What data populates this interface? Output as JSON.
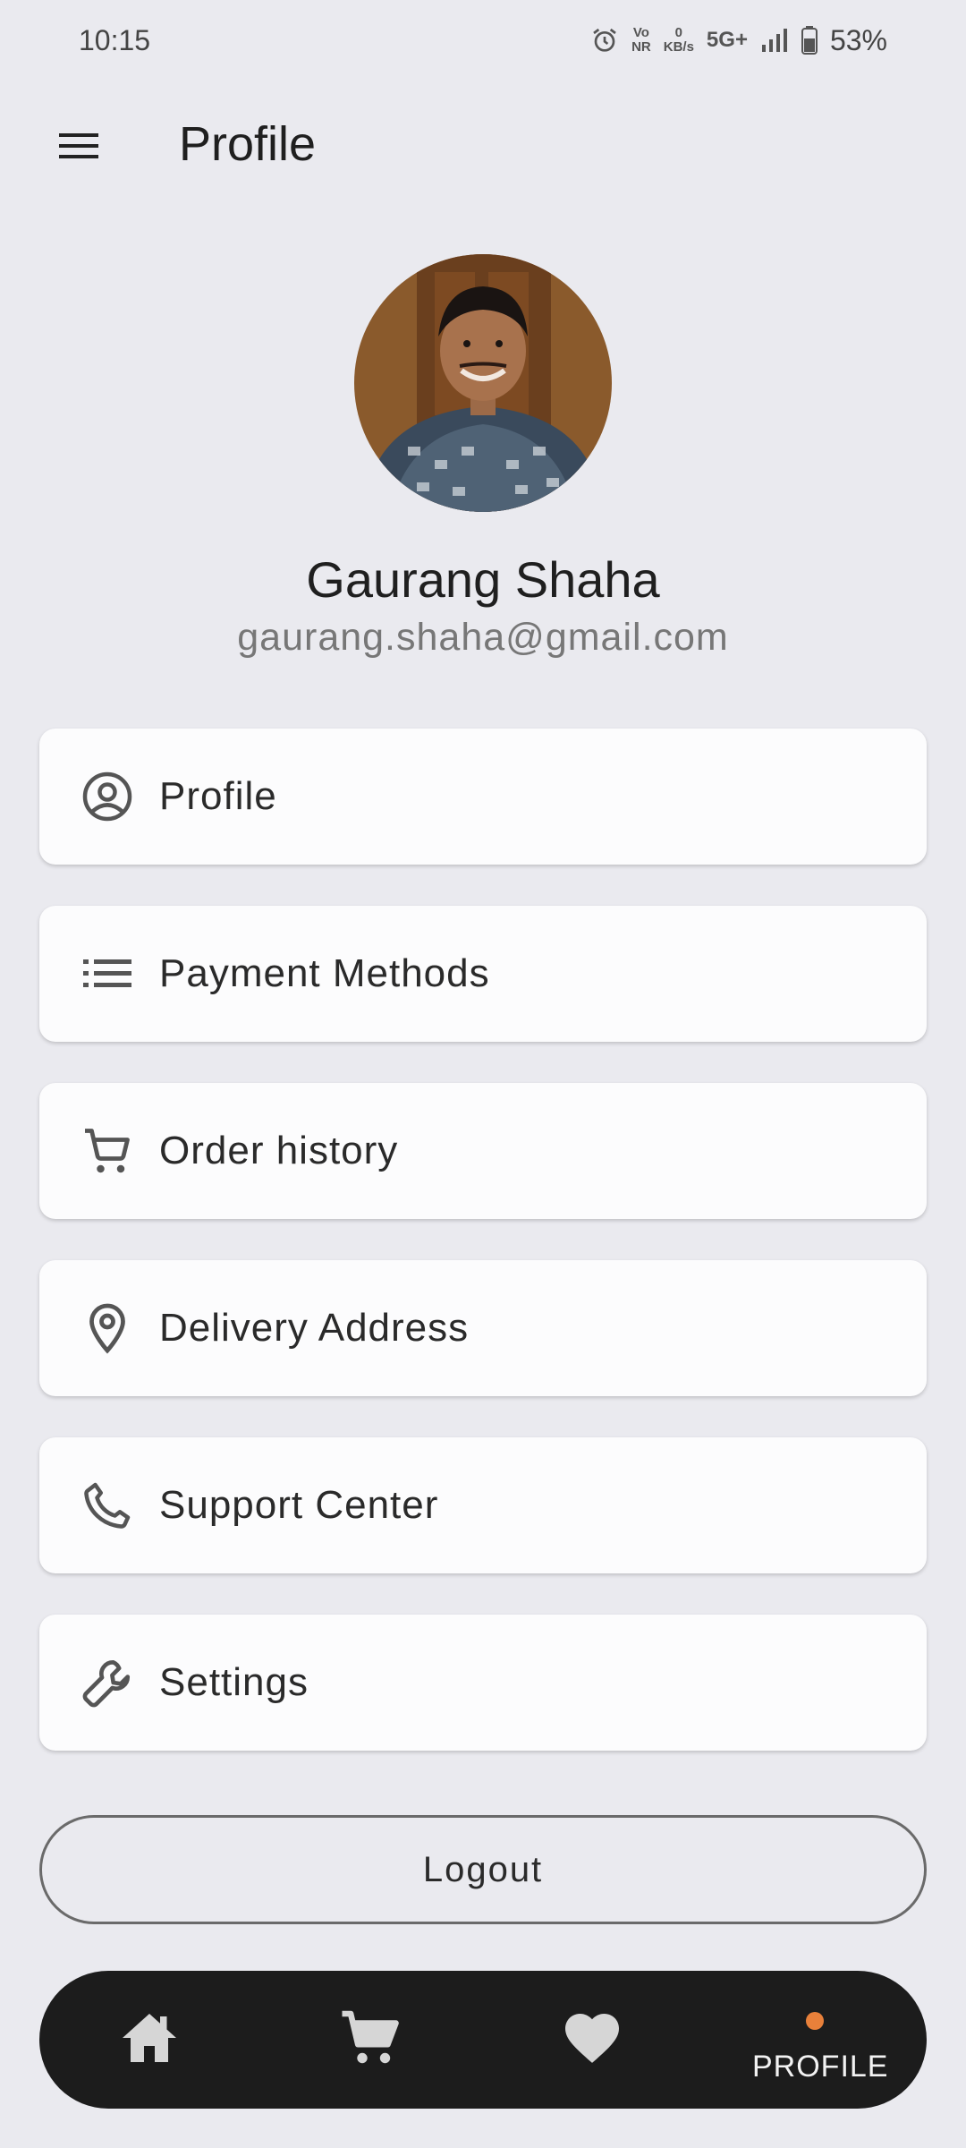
{
  "status_bar": {
    "time": "10:15",
    "volte_top": "Vo",
    "volte_bottom": "NR",
    "speed_value": "0",
    "speed_unit": "KB/s",
    "network": "5G+",
    "battery": "53%"
  },
  "app_bar": {
    "title": "Profile",
    "menu_icon": "hamburger-menu-icon"
  },
  "user": {
    "name": "Gaurang Shaha",
    "email": "gaurang.shaha@gmail.com"
  },
  "menu": {
    "items": [
      {
        "label": "Profile",
        "icon": "account-circle-icon"
      },
      {
        "label": "Payment Methods",
        "icon": "list-icon"
      },
      {
        "label": "Order history",
        "icon": "cart-icon"
      },
      {
        "label": "Delivery Address",
        "icon": "location-pin-icon"
      },
      {
        "label": "Support Center",
        "icon": "phone-icon"
      },
      {
        "label": "Settings",
        "icon": "wrench-icon"
      }
    ]
  },
  "logout": {
    "label": "Logout"
  },
  "bottom_nav": {
    "items": [
      {
        "icon": "home-icon"
      },
      {
        "icon": "cart-icon"
      },
      {
        "icon": "heart-icon"
      },
      {
        "icon": "profile",
        "label": "PROFILE",
        "active": true
      }
    ],
    "active_dot_color": "#e8803a",
    "background": "#1c1c1c"
  },
  "colors": {
    "background": "#eaeaef",
    "card": "#fcfcfd",
    "text": "#222222",
    "muted": "#777777"
  }
}
